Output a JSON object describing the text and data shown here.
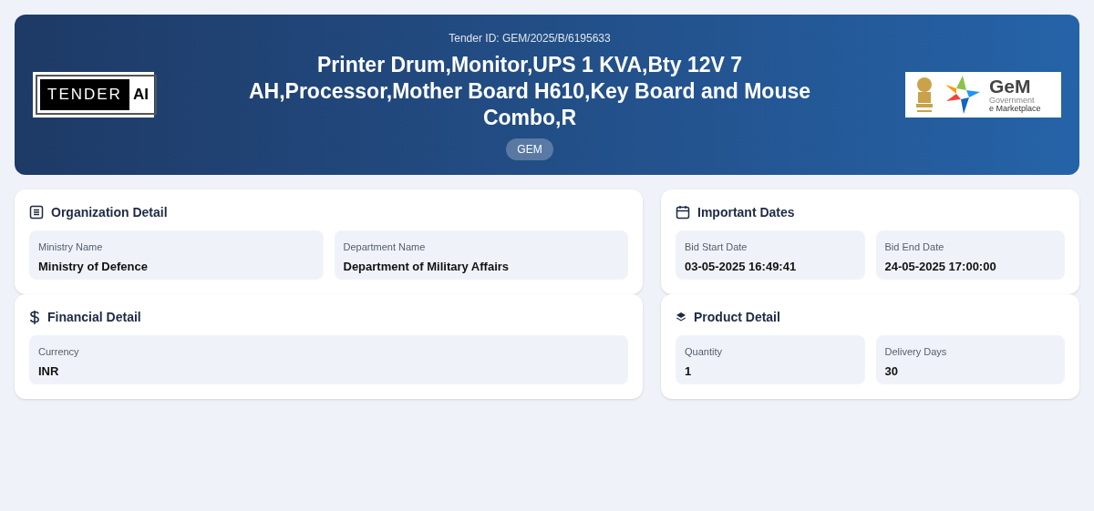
{
  "header": {
    "logo": {
      "word": "TENDER",
      "badge": "AI"
    },
    "tender_id": "Tender ID: GEM/2025/B/6195633",
    "title": "Printer Drum,Monitor,UPS 1 KVA,Bty 12V 7 AH,Processor,Mother Board H610,Key Board and Mouse Combo,R",
    "source_badge": "GEM",
    "partner_logo": {
      "name": "GeM",
      "line_1": "Government",
      "line_2": "e Marketplace"
    }
  },
  "sections": [
    {
      "kind": "organization",
      "title": "Organization Detail",
      "fields": [
        {
          "label": "Ministry Name",
          "value": "Ministry of Defence"
        },
        {
          "label": "Department Name",
          "value": "Department of Military Affairs"
        }
      ]
    },
    {
      "kind": "dates",
      "title": "Important Dates",
      "fields": [
        {
          "label": "Bid Start Date",
          "value": "03-05-2025 16:49:41"
        },
        {
          "label": "Bid End Date",
          "value": "24-05-2025 17:00:00"
        }
      ]
    },
    {
      "kind": "financial",
      "title": "Financial Detail",
      "fields": [
        {
          "label": "Currency",
          "value": "INR"
        }
      ]
    },
    {
      "kind": "product",
      "title": "Product Detail",
      "fields": [
        {
          "label": "Quantity",
          "value": "1"
        },
        {
          "label": "Delivery Days",
          "value": "30"
        }
      ]
    }
  ]
}
